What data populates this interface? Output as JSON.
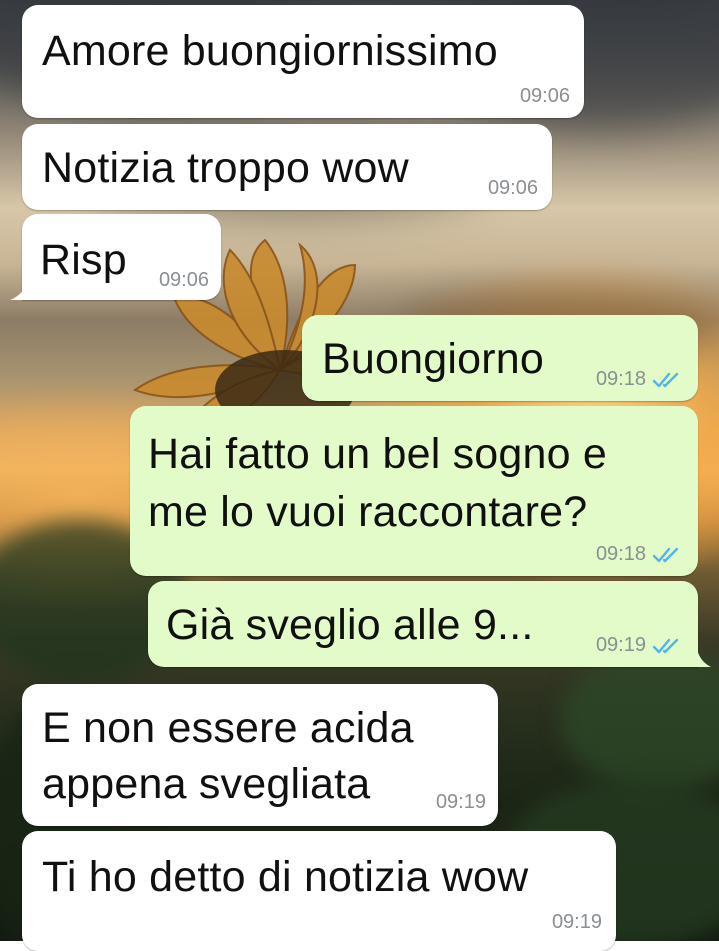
{
  "messages": [
    {
      "direction": "in",
      "text": "Amore buongiornissimo",
      "time": "09:06"
    },
    {
      "direction": "in",
      "text": "Notizia troppo wow",
      "time": "09:06"
    },
    {
      "direction": "in",
      "text": "Risp",
      "time": "09:06"
    },
    {
      "direction": "out",
      "text": "Buongiorno",
      "time": "09:18",
      "status": "read"
    },
    {
      "direction": "out",
      "text_lines": [
        "Hai fatto un bel sogno e",
        "me lo vuoi raccontare?"
      ],
      "time": "09:18",
      "status": "read"
    },
    {
      "direction": "out",
      "text": "Già sveglio alle 9...",
      "time": "09:19",
      "status": "read"
    },
    {
      "direction": "in",
      "text_lines": [
        "E non essere acida",
        "appena svegliata"
      ],
      "time": "09:19"
    },
    {
      "direction": "in",
      "text": "Ti ho detto di notizia wow",
      "time": "09:19"
    }
  ],
  "colors": {
    "incoming_bubble": "#ffffff",
    "outgoing_bubble": "#e3fbc9",
    "timestamp": "#8a8f93",
    "read_ticks": "#4fb6ec"
  },
  "icons": {
    "read_receipt": "double-check-icon",
    "wallpaper": "sunflower-sunset-wallpaper"
  }
}
